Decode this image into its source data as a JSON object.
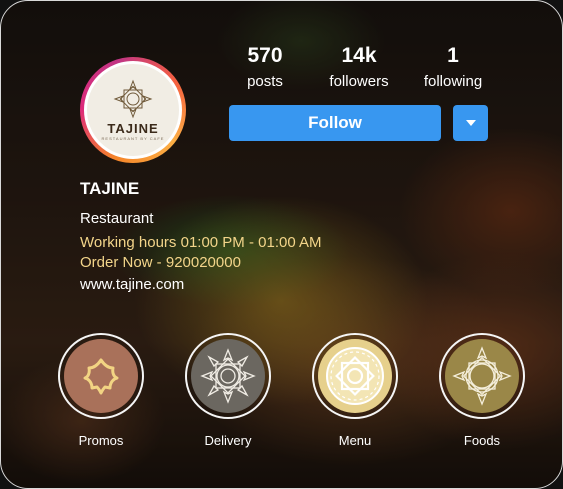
{
  "profile": {
    "logo_text": "TAJINE",
    "logo_tagline": "RESTAURANT BY CAFE",
    "name": "TAJINE",
    "category": "Restaurant",
    "hours": "Working hours 01:00 PM - 01:00 AM",
    "order": "Order Now - 920020000",
    "website": "www.tajine.com"
  },
  "stats": [
    {
      "value": "570",
      "label": "posts"
    },
    {
      "value": "14k",
      "label": "followers"
    },
    {
      "value": "1",
      "label": "following"
    }
  ],
  "actions": {
    "follow_label": "Follow",
    "dropdown_icon": "chevron-down-icon"
  },
  "highlights": [
    {
      "label": "Promos",
      "icon": "fleur-icon",
      "color": "#a9715a"
    },
    {
      "label": "Delivery",
      "icon": "mandala-icon",
      "color": "#6b6760"
    },
    {
      "label": "Menu",
      "icon": "mandala-icon",
      "color": "#e6d08c"
    },
    {
      "label": "Foods",
      "icon": "mandala-icon",
      "color": "#9a8748"
    }
  ],
  "colors": {
    "accent": "#3897f0",
    "highlight_text": "#f3d58a"
  }
}
